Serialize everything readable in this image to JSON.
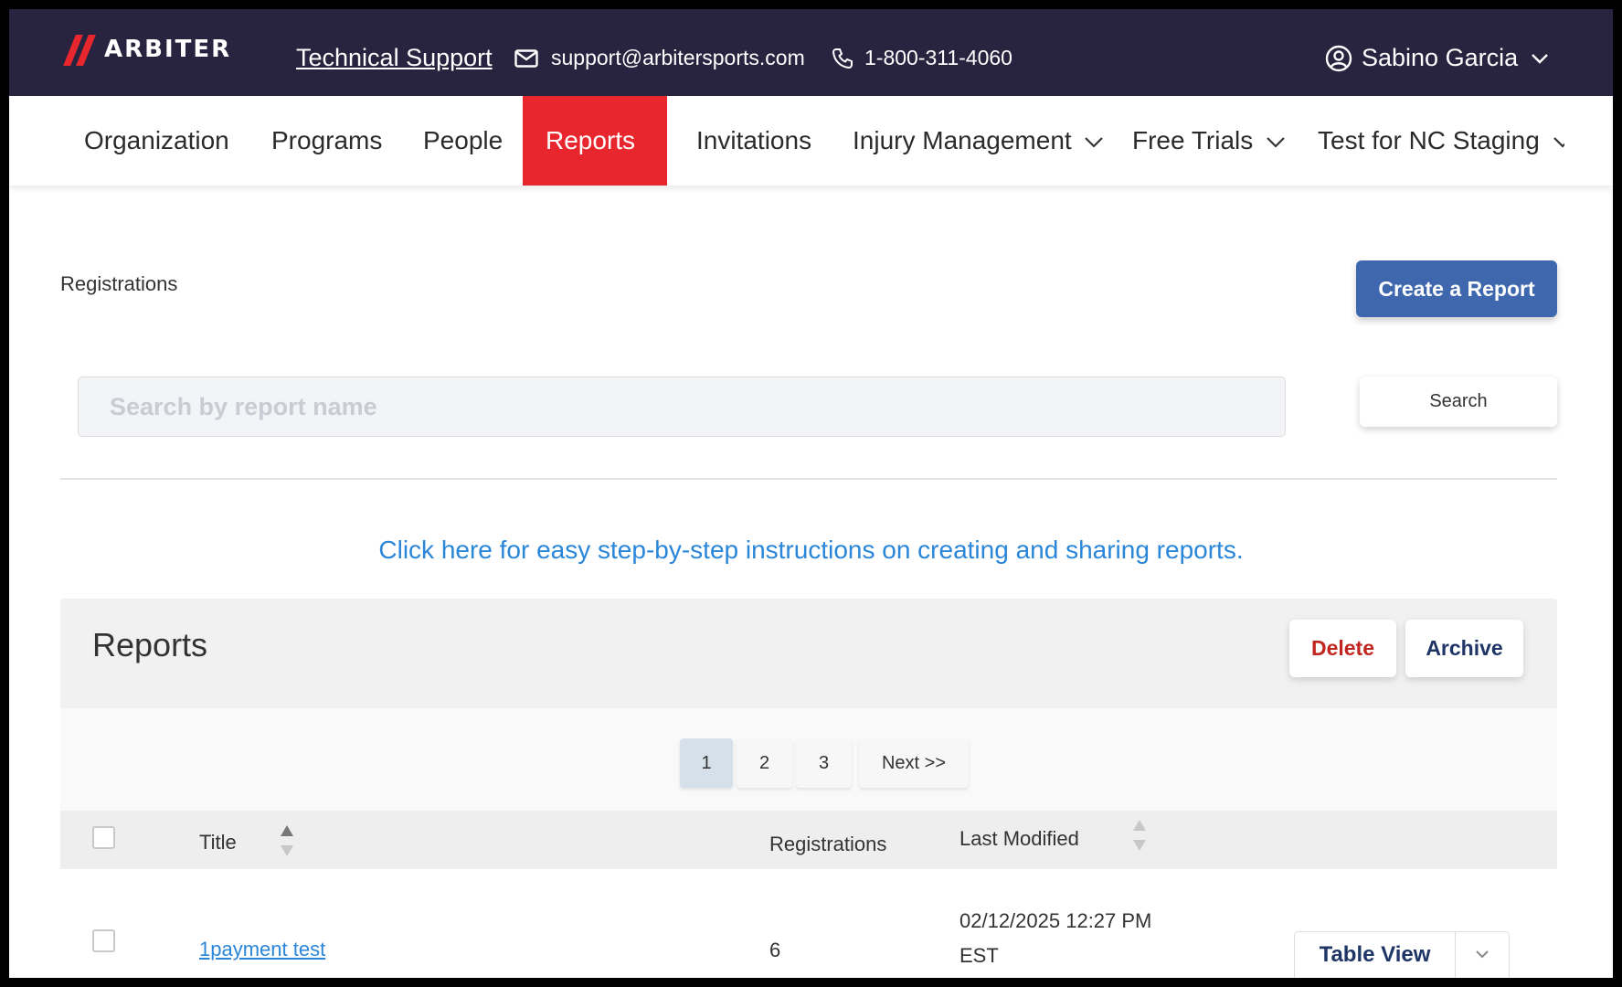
{
  "header": {
    "brand": "ARBITER",
    "technical_support": "Technical Support",
    "email": "support@arbitersports.com",
    "phone": "1-800-311-4060",
    "user_name": "Sabino Garcia"
  },
  "nav": {
    "items": [
      {
        "label": "Organization"
      },
      {
        "label": "Programs"
      },
      {
        "label": "People"
      },
      {
        "label": "Reports",
        "active": true
      },
      {
        "label": "Invitations"
      },
      {
        "label": "Injury Management"
      },
      {
        "label": "Free Trials"
      },
      {
        "label": "Test for NC Staging"
      }
    ]
  },
  "page": {
    "breadcrumb": "Registrations",
    "create_button": "Create a Report",
    "search_placeholder": "Search by report name",
    "search_button": "Search",
    "help_link": "Click here for easy step-by-step instructions on creating and sharing reports."
  },
  "reports": {
    "title": "Reports",
    "delete_label": "Delete",
    "archive_label": "Archive",
    "pagination": {
      "pages": [
        "1",
        "2",
        "3"
      ],
      "current": "1",
      "next_label": "Next >>"
    },
    "columns": {
      "title": "Title",
      "registrations": "Registrations",
      "last_modified": "Last Modified"
    },
    "rows": [
      {
        "title": "1payment test",
        "registrations": "6",
        "last_modified_line1": "02/12/2025 12:27 PM",
        "last_modified_line2": "EST",
        "view_label": "Table View"
      }
    ]
  },
  "colors": {
    "header_bg": "#28243f",
    "active_nav": "#e8262d",
    "primary_button": "#3f67ad",
    "link": "#2a86d8",
    "delete_text": "#c0261f"
  },
  "icons": [
    "mail-icon",
    "phone-icon",
    "user-circle-icon",
    "chevron-down-icon",
    "sort-arrows-icon"
  ]
}
